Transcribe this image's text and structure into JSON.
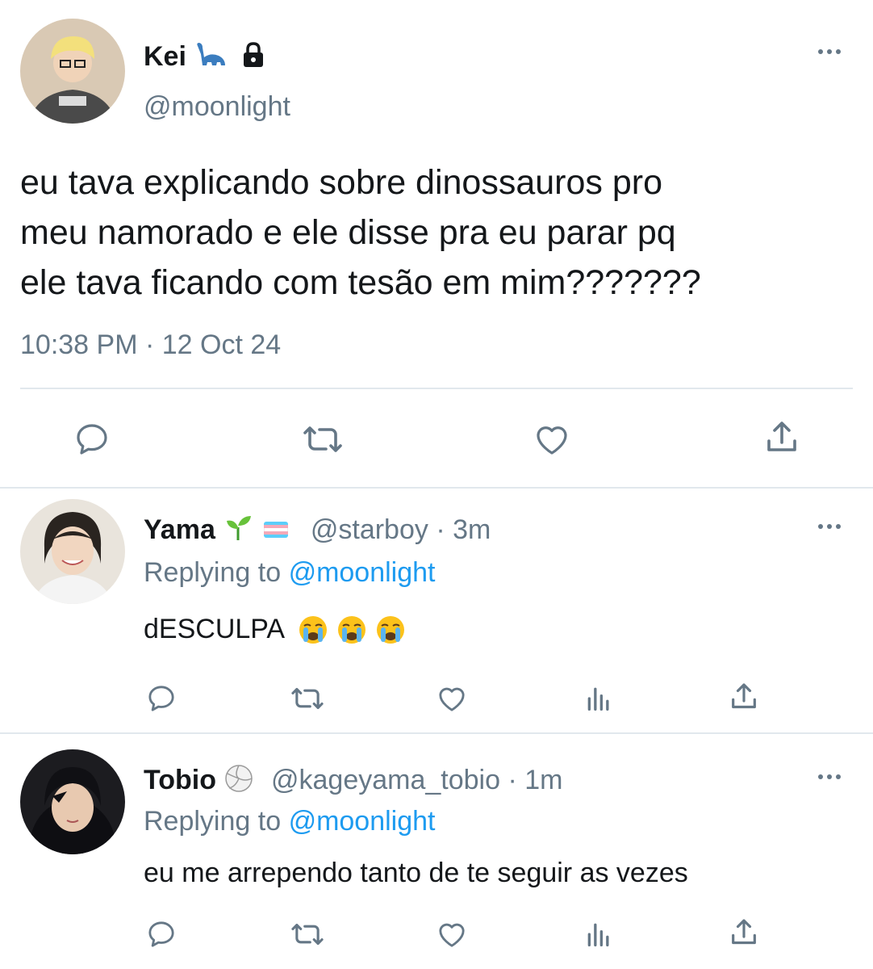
{
  "main_tweet": {
    "author_name": "Kei",
    "name_emojis": [
      "sauropod-emoji",
      "lock-icon"
    ],
    "handle": "@moonlight",
    "text_lines": [
      "eu tava explicando sobre dinossauros pro",
      "meu namorado e ele disse pra eu parar pq",
      "ele tava ficando com tesão em mim???????"
    ],
    "timestamp": "10:38 PM · 12 Oct 24",
    "actions": [
      "reply-icon",
      "retweet-icon",
      "like-icon",
      "share-icon"
    ]
  },
  "replies": [
    {
      "author_name": "Yama",
      "name_emojis": [
        "seedling-emoji",
        "transgender-flag-emoji"
      ],
      "handle_time": "@starboy · 3m",
      "replying_prefix": "Replying to",
      "replying_handle": "@moonlight",
      "text": "dESCULPA",
      "text_emojis": [
        "loudly-crying-face-emoji",
        "loudly-crying-face-emoji",
        "loudly-crying-face-emoji"
      ],
      "actions": [
        "reply-icon",
        "retweet-icon",
        "like-icon",
        "analytics-icon",
        "share-icon"
      ]
    },
    {
      "author_name": "Tobio",
      "name_emojis": [
        "volleyball-emoji"
      ],
      "handle_time": "@kageyama_tobio · 1m",
      "replying_prefix": "Replying to",
      "replying_handle": "@moonlight",
      "text": "eu me arrependo tanto de te seguir as vezes",
      "actions": [
        "reply-icon",
        "retweet-icon",
        "like-icon",
        "analytics-icon",
        "share-icon"
      ]
    }
  ],
  "colors": {
    "link": "#1d9bf0",
    "muted": "#657786",
    "divider": "#e1e8ed",
    "trans_flag": [
      "#5BCEFA",
      "#F5A9B8",
      "#FFFFFF",
      "#F5A9B8",
      "#5BCEFA"
    ]
  }
}
